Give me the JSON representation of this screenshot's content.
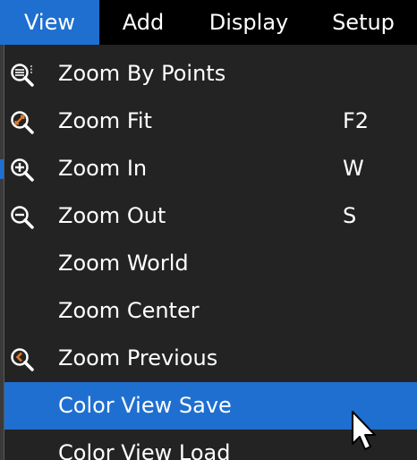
{
  "menubar": {
    "items": [
      {
        "label": "View",
        "active": true
      },
      {
        "label": "Add",
        "active": false
      },
      {
        "label": "Display",
        "active": false
      },
      {
        "label": "Setup",
        "active": false
      }
    ]
  },
  "menu": {
    "items": [
      {
        "label": "Zoom By Points",
        "shortcut": "",
        "icon": "zoom-by-points-icon"
      },
      {
        "label": "Zoom Fit",
        "shortcut": "F2",
        "icon": "zoom-fit-icon"
      },
      {
        "label": "Zoom In",
        "shortcut": "W",
        "icon": "zoom-in-icon"
      },
      {
        "label": "Zoom Out",
        "shortcut": "S",
        "icon": "zoom-out-icon"
      },
      {
        "label": "Zoom World",
        "shortcut": "",
        "icon": ""
      },
      {
        "label": "Zoom Center",
        "shortcut": "",
        "icon": ""
      },
      {
        "label": "Zoom Previous",
        "shortcut": "",
        "icon": "zoom-previous-icon"
      },
      {
        "label": "Color View Save",
        "shortcut": "",
        "icon": "",
        "highlighted": true
      },
      {
        "label": "Color View Load",
        "shortcut": "",
        "icon": ""
      }
    ]
  },
  "colors": {
    "accent": "#1e6fd0",
    "menu_bg": "#232323",
    "menubar_bg": "#000000",
    "text": "#ffffff",
    "zoom_fit_accent": "#e07a2a"
  }
}
